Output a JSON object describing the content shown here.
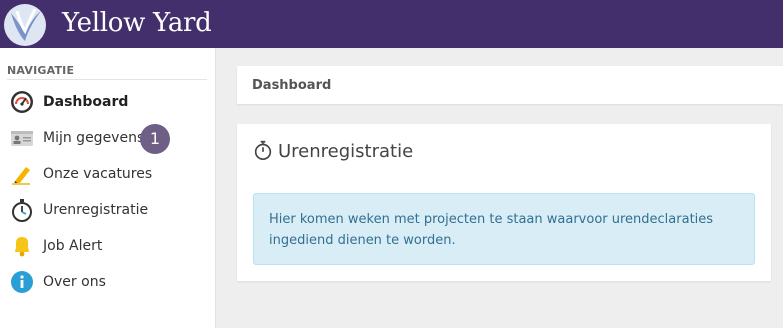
{
  "brand": {
    "name": "Yellow Yard"
  },
  "sidebar": {
    "heading": "NAVIGATIE",
    "items": [
      {
        "label": "Dashboard",
        "icon": "speedometer-icon",
        "active": true
      },
      {
        "label": "Mijn gegevens",
        "icon": "id-card-icon",
        "badge": "1"
      },
      {
        "label": "Onze vacatures",
        "icon": "pen-icon"
      },
      {
        "label": "Urenregistratie",
        "icon": "stopwatch-icon"
      },
      {
        "label": "Job Alert",
        "icon": "bell-icon"
      },
      {
        "label": "Over ons",
        "icon": "info-icon"
      }
    ]
  },
  "header": {
    "title": "Dashboard"
  },
  "card": {
    "icon": "stopwatch-icon",
    "title": "Urenregistratie",
    "message": "Hier komen weken met projecten te staan waarvoor urendeclaraties ingediend dienen te worden."
  },
  "colors": {
    "topbar": "#432f6b",
    "badge": "#6e5f86",
    "info_background": "#d9edf7",
    "info_text": "#31708f"
  }
}
